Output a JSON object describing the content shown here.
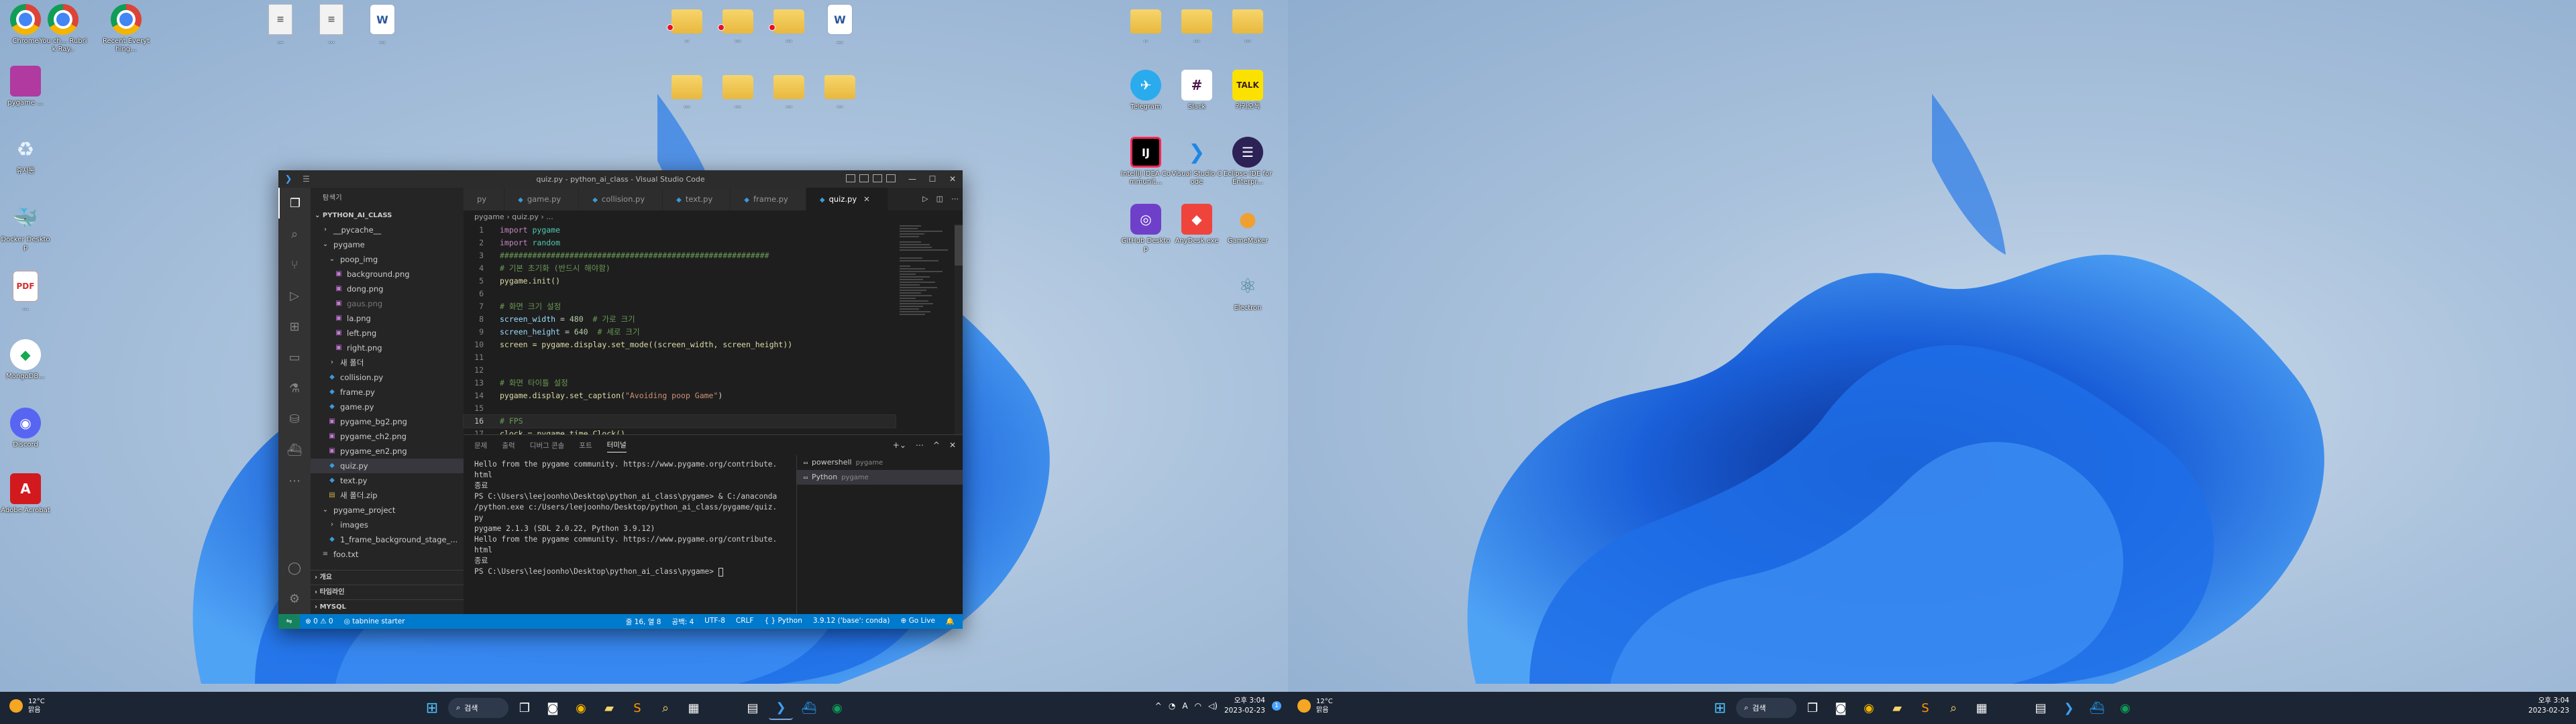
{
  "desktop_left": {
    "col1": [
      {
        "label": "Chrome",
        "icon": "chrome-icon"
      },
      {
        "label": "",
        "icon": "purple-app-icon",
        "label_text": "pygame ..."
      },
      {
        "label": "휴지통",
        "icon": "recycle-bin-icon"
      },
      {
        "label": "Docker Desktop",
        "icon": "docker-icon"
      },
      {
        "label": "...",
        "icon": "pdf-icon"
      },
      {
        "label": "MongoDB...",
        "icon": "mongodb-icon"
      },
      {
        "label": "Discord",
        "icon": "discord-icon"
      },
      {
        "label": "Adobe Acrobat",
        "icon": "acrobat-icon"
      }
    ],
    "row_top": [
      {
        "label": "You ch... Rubrik Ray..",
        "icon": "chrome-icon"
      },
      {
        "label": "Recent Everything...",
        "icon": "chrome-icon"
      }
    ],
    "files": [
      {
        "label": "...",
        "icon": "file-icon"
      },
      {
        "label": "...",
        "icon": "file-icon"
      },
      {
        "label": "...",
        "icon": "word-icon"
      }
    ],
    "folders_top": [
      {
        "label": "..",
        "icon": "folder-icon"
      },
      {
        "label": "...",
        "icon": "folder-icon"
      },
      {
        "label": "...",
        "icon": "folder-icon"
      },
      {
        "label": "...",
        "icon": "word-icon"
      }
    ],
    "folders_second": [
      {
        "label": "...",
        "icon": "folder-icon"
      },
      {
        "label": "...",
        "icon": "folder-icon"
      },
      {
        "label": "...",
        "icon": "folder-icon"
      },
      {
        "label": "...",
        "icon": "folder-icon"
      }
    ],
    "folders_right": [
      {
        "label": "..",
        "icon": "folder-icon"
      },
      {
        "label": "...",
        "icon": "folder-icon"
      },
      {
        "label": "...",
        "icon": "folder-icon"
      }
    ],
    "apps_right": [
      {
        "label": "Telegram",
        "icon": "telegram-icon"
      },
      {
        "label": "Slack",
        "icon": "slack-icon"
      },
      {
        "label": "카카오톡",
        "icon": "kakaotalk-icon"
      },
      {
        "label": "IntelliJ IDEA Communit...",
        "icon": "intellij-icon"
      },
      {
        "label": "Visual Studio Code",
        "icon": "vscode-icon"
      },
      {
        "label": "Eclipse IDE for Enterpr...",
        "icon": "eclipse-icon"
      },
      {
        "label": "GitHub Desktop",
        "icon": "github-desktop-icon"
      },
      {
        "label": "AnyDesk.exe",
        "icon": "anydesk-icon"
      },
      {
        "label": "GameMaker",
        "icon": "gamemaker-icon"
      },
      {
        "label": "Electron",
        "icon": "electron-icon"
      }
    ]
  },
  "vscode": {
    "title": "quiz.py - python_ai_class - Visual Studio Code",
    "explorer_header": "탐색기",
    "project": "PYTHON_AI_CLASS",
    "tree": [
      {
        "label": "__pycache__",
        "type": "folder",
        "indent": 1,
        "dim": false
      },
      {
        "label": "pygame",
        "type": "folder-open",
        "indent": 1,
        "dim": false
      },
      {
        "label": "poop_img",
        "type": "folder-open",
        "indent": 2,
        "dim": false
      },
      {
        "label": "background.png",
        "type": "img",
        "indent": 3,
        "dim": false
      },
      {
        "label": "dong.png",
        "type": "img",
        "indent": 3,
        "dim": false
      },
      {
        "label": "gaus.png",
        "type": "img",
        "indent": 3,
        "dim": true
      },
      {
        "label": "la.png",
        "type": "img",
        "indent": 3,
        "dim": false
      },
      {
        "label": "left.png",
        "type": "img",
        "indent": 3,
        "dim": false
      },
      {
        "label": "right.png",
        "type": "img",
        "indent": 3,
        "dim": false
      },
      {
        "label": "새 폴더",
        "type": "folder",
        "indent": 2,
        "dim": false
      },
      {
        "label": "collision.py",
        "type": "py",
        "indent": 2,
        "dim": false
      },
      {
        "label": "frame.py",
        "type": "py",
        "indent": 2,
        "dim": false
      },
      {
        "label": "game.py",
        "type": "py",
        "indent": 2,
        "dim": false
      },
      {
        "label": "pygame_bg2.png",
        "type": "img",
        "indent": 2,
        "dim": false
      },
      {
        "label": "pygame_ch2.png",
        "type": "img",
        "indent": 2,
        "dim": false
      },
      {
        "label": "pygame_en2.png",
        "type": "img",
        "indent": 2,
        "dim": false
      },
      {
        "label": "quiz.py",
        "type": "py",
        "indent": 2,
        "dim": false,
        "selected": true
      },
      {
        "label": "text.py",
        "type": "py",
        "indent": 2,
        "dim": false
      },
      {
        "label": "새 폴더.zip",
        "type": "zip",
        "indent": 2,
        "dim": false
      },
      {
        "label": "pygame_project",
        "type": "folder-open",
        "indent": 1,
        "dim": false
      },
      {
        "label": "images",
        "type": "folder",
        "indent": 2,
        "dim": false
      },
      {
        "label": "1_frame_background_stage_...",
        "type": "py",
        "indent": 2,
        "dim": false
      },
      {
        "label": "foo.txt",
        "type": "txt",
        "indent": 1,
        "dim": false
      }
    ],
    "sections": [
      "개요",
      "타임라인",
      "MYSQL"
    ],
    "tabs": [
      {
        "label": "py",
        "active": false
      },
      {
        "label": "game.py",
        "active": false
      },
      {
        "label": "collision.py",
        "active": false
      },
      {
        "label": "text.py",
        "active": false
      },
      {
        "label": "frame.py",
        "active": false
      },
      {
        "label": "quiz.py",
        "active": true
      }
    ],
    "breadcrumb": "pygame › quiz.py › ...",
    "code_lines": [
      {
        "n": "1",
        "text": "import pygame",
        "kind": "import"
      },
      {
        "n": "2",
        "text": "import random",
        "kind": "import"
      },
      {
        "n": "3",
        "text": "##########################################################",
        "kind": "comment"
      },
      {
        "n": "4",
        "text": "# 기본 초기화 (반드시 해야함)",
        "kind": "comment"
      },
      {
        "n": "5",
        "text": "pygame.init()",
        "kind": "call"
      },
      {
        "n": "6",
        "text": "",
        "kind": "blank"
      },
      {
        "n": "7",
        "text": "# 화면 크기 설정",
        "kind": "comment"
      },
      {
        "n": "8",
        "text": "screen_width = 480  # 가로 크기",
        "kind": "assign"
      },
      {
        "n": "9",
        "text": "screen_height = 640  # 세로 크기",
        "kind": "assign"
      },
      {
        "n": "10",
        "text": "screen = pygame.display.set_mode((screen_width, screen_height))",
        "kind": "call"
      },
      {
        "n": "11",
        "text": "",
        "kind": "blank"
      },
      {
        "n": "12",
        "text": "",
        "kind": "blank"
      },
      {
        "n": "13",
        "text": "# 화면 타이틀 설정",
        "kind": "comment"
      },
      {
        "n": "14",
        "text": "pygame.display.set_caption(\"Avoiding poop Game\")",
        "kind": "caption"
      },
      {
        "n": "15",
        "text": "",
        "kind": "blank"
      },
      {
        "n": "16",
        "text": "# FPS",
        "kind": "comment",
        "current": true
      },
      {
        "n": "17",
        "text": "clock = pygame.time.Clock()",
        "kind": "call"
      }
    ],
    "panel_tabs": [
      "문제",
      "출력",
      "디버그 콘솔",
      "포트",
      "터미널"
    ],
    "panel_active": "터미널",
    "terminal_lines": [
      "Hello from the pygame community. https://www.pygame.org/contribute.",
      "html",
      "종료",
      "PS C:\\Users\\leejoonho\\Desktop\\python_ai_class\\pygame> & C:/anaconda",
      "/python.exe c:/Users/leejoonho/Desktop/python_ai_class/pygame/quiz.",
      "py",
      "pygame 2.1.3 (SDL 2.0.22, Python 3.9.12)",
      "Hello from the pygame community. https://www.pygame.org/contribute.",
      "html",
      "종료"
    ],
    "terminal_prompt": "PS C:\\Users\\leejoonho\\Desktop\\python_ai_class\\pygame> ",
    "terminal_list": [
      {
        "label": "powershell",
        "sub": "pygame",
        "selected": false
      },
      {
        "label": "Python",
        "sub": "pygame",
        "selected": true
      }
    ],
    "status_left": [
      "⊗ 0 ⚠ 0",
      "◎ tabnine starter"
    ],
    "status_right": [
      "줄 16, 열 8",
      "공백: 4",
      "UTF-8",
      "CRLF",
      "{ } Python",
      "3.9.12 ('base': conda)",
      "⊕ Go Live"
    ]
  },
  "taskbar_left": {
    "temp": "12°C",
    "cond": "맑음",
    "search": "검색",
    "time": "오후 3:04",
    "date": "2023-02-23",
    "notif": "1"
  },
  "taskbar_right": {
    "temp": "12°C",
    "cond": "맑음",
    "search": "검색",
    "time": "오후 3:04",
    "date": "2023-02-23"
  },
  "colors": {
    "vscode_blue": "#007acc",
    "taskbar": "#1c2533",
    "wallpaper_blue": "#1a5fd8"
  }
}
